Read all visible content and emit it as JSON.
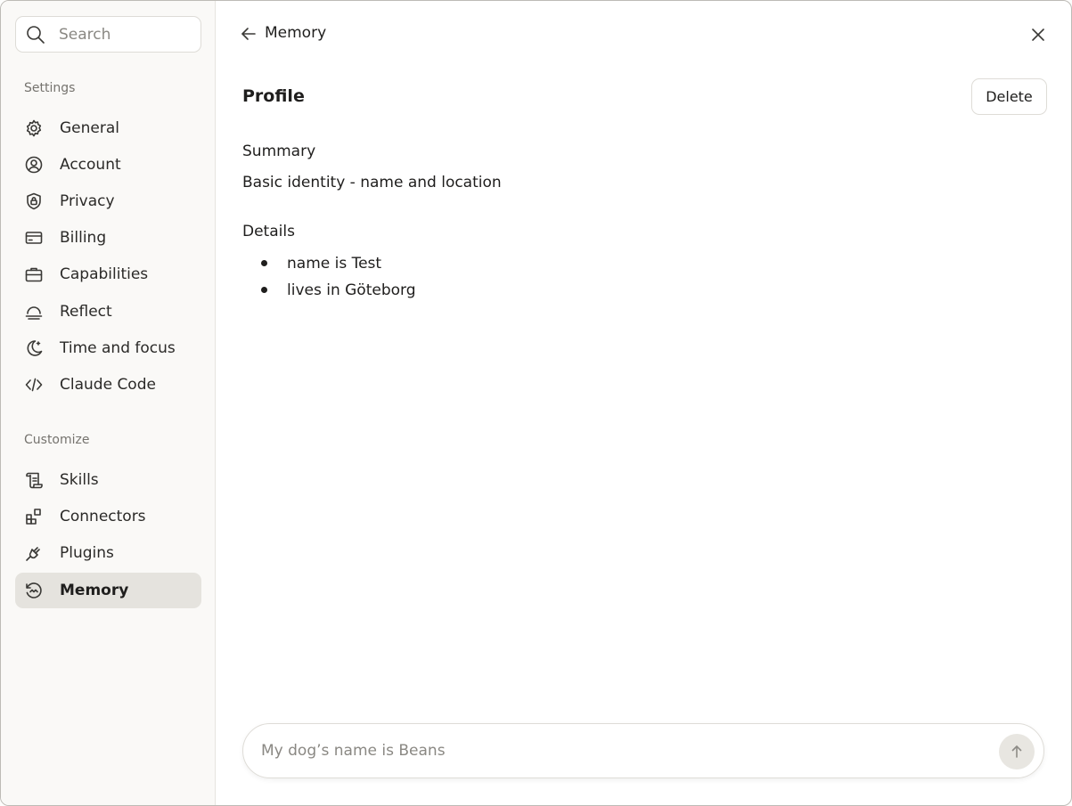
{
  "search": {
    "placeholder": "Search"
  },
  "sidebar": {
    "settings_label": "Settings",
    "settings_items": [
      {
        "label": "General",
        "icon": "gear-icon"
      },
      {
        "label": "Account",
        "icon": "user-circle-icon"
      },
      {
        "label": "Privacy",
        "icon": "shield-lock-icon"
      },
      {
        "label": "Billing",
        "icon": "credit-card-icon"
      },
      {
        "label": "Capabilities",
        "icon": "briefcase-icon"
      },
      {
        "label": "Reflect",
        "icon": "sunset-icon"
      },
      {
        "label": "Time and focus",
        "icon": "moon-icon"
      },
      {
        "label": "Claude Code",
        "icon": "code-icon"
      }
    ],
    "customize_label": "Customize",
    "customize_items": [
      {
        "label": "Skills",
        "icon": "scroll-icon"
      },
      {
        "label": "Connectors",
        "icon": "blocks-icon"
      },
      {
        "label": "Plugins",
        "icon": "plug-icon"
      },
      {
        "label": "Memory",
        "icon": "memory-icon",
        "active": true
      }
    ]
  },
  "header": {
    "title": "Memory"
  },
  "profile": {
    "title": "Profile",
    "delete_label": "Delete",
    "summary_heading": "Summary",
    "summary_text": "Basic identity - name and location",
    "details_heading": "Details",
    "details": [
      "name is Test",
      "lives in Göteborg"
    ]
  },
  "composer": {
    "placeholder": "My dog’s name is Beans"
  },
  "colors": {
    "active_bg": "#e5e3de",
    "sidebar_bg": "#faf9f7",
    "send_bg": "#e8e6e1"
  }
}
